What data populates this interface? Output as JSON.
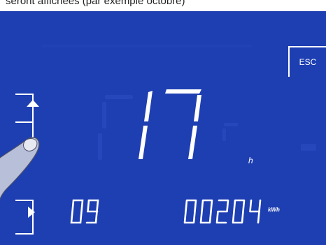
{
  "caption": "seront affichées (par exemple octobre)",
  "buttons": {
    "esc_label": "ESC",
    "up_icon": "triangle-up-icon",
    "next_icon": "triangle-right-icon"
  },
  "display": {
    "hours_value": "17",
    "hours_unit": "h",
    "month_value": "09",
    "energy_value": "00204",
    "energy_unit": "kWh"
  },
  "colors": {
    "screen": "#1e3fb2",
    "segment": "#ffffff"
  }
}
